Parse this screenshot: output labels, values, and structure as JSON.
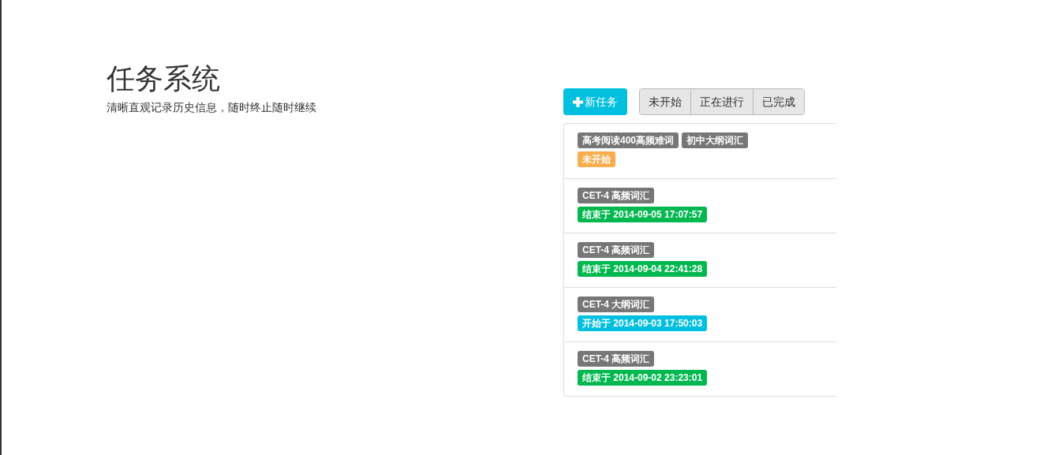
{
  "header": {
    "title": "任务系统",
    "subtitle": "清晰直观记录历史信息，随时终止随时继续"
  },
  "new_task_button": {
    "label": "新任务"
  },
  "filters": [
    "未开始",
    "正在进行",
    "已完成"
  ],
  "tasks": [
    {
      "tags": [
        "高考阅读400高频难词",
        "初中大纲词汇"
      ],
      "status": {
        "kind": "not_started",
        "text": "未开始"
      }
    },
    {
      "tags": [
        "CET-4 高频词汇"
      ],
      "status": {
        "kind": "ended",
        "text": "结束于 2014-09-05 17:07:57"
      }
    },
    {
      "tags": [
        "CET-4 高频词汇"
      ],
      "status": {
        "kind": "ended",
        "text": "结束于 2014-09-04 22:41:28"
      }
    },
    {
      "tags": [
        "CET-4 大纲词汇"
      ],
      "status": {
        "kind": "started",
        "text": "开始于 2014-09-03 17:50:03"
      }
    },
    {
      "tags": [
        "CET-4 高频词汇"
      ],
      "status": {
        "kind": "ended",
        "text": "结束于 2014-09-02 23:23:01"
      }
    }
  ]
}
